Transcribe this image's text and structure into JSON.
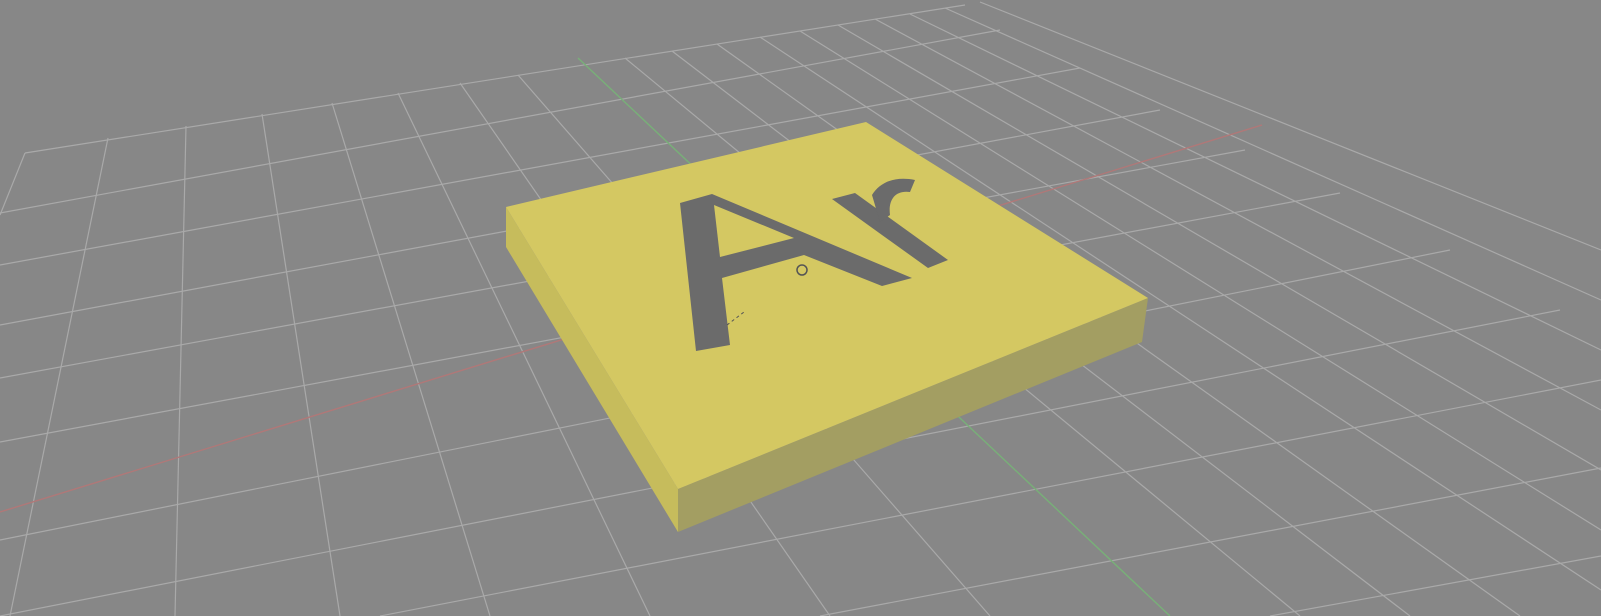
{
  "viewport": {
    "background_color": "#878787",
    "grid_color": "#a9a9a9"
  },
  "axes": {
    "x_axis_color": "#b07878",
    "y_axis_color": "#78b078"
  },
  "model": {
    "object_type": "extruded-text-plate",
    "engraved_text": "Ar",
    "top_face_color": "#d4c862",
    "front_face_color": "#a39e62",
    "side_face_color": "#c6bc5c",
    "text_color": "#6b6b6b"
  }
}
